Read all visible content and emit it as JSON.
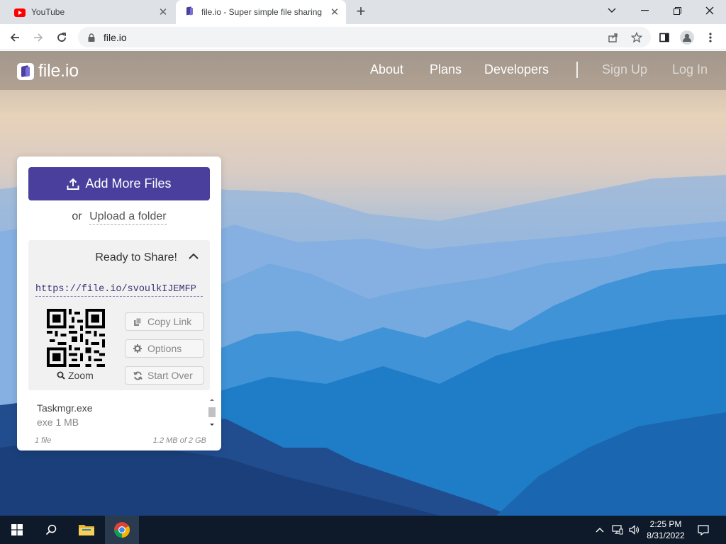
{
  "browser": {
    "tabs": [
      {
        "title": "YouTube",
        "icon": "youtube-icon",
        "active": false
      },
      {
        "title": "file.io - Super simple file sharing",
        "icon": "fileio-icon",
        "active": true
      }
    ],
    "address": "file.io"
  },
  "site": {
    "logo_text": "file.io",
    "nav": {
      "about": "About",
      "plans": "Plans",
      "developers": "Developers",
      "sign_up": "Sign Up",
      "log_in": "Log In"
    }
  },
  "upload": {
    "add_button": "Add More Files",
    "or_text": "or",
    "folder_link": "Upload a folder",
    "share": {
      "title": "Ready to Share!",
      "url": "https://file.io/svoulkIJEMFP",
      "zoom_label": "Zoom",
      "copy_link": "Copy Link",
      "options": "Options",
      "start_over": "Start Over"
    },
    "file": {
      "name": "Taskmgr.exe",
      "meta": "exe 1 MB"
    },
    "footer": {
      "count": "1 file",
      "usage": "1.2 MB of 2 GB"
    }
  },
  "taskbar": {
    "time": "2:25 PM",
    "date": "8/31/2022"
  },
  "colors": {
    "brand": "#4a3f9d",
    "link": "#3b3374",
    "taskbar": "#0e1a2a"
  }
}
